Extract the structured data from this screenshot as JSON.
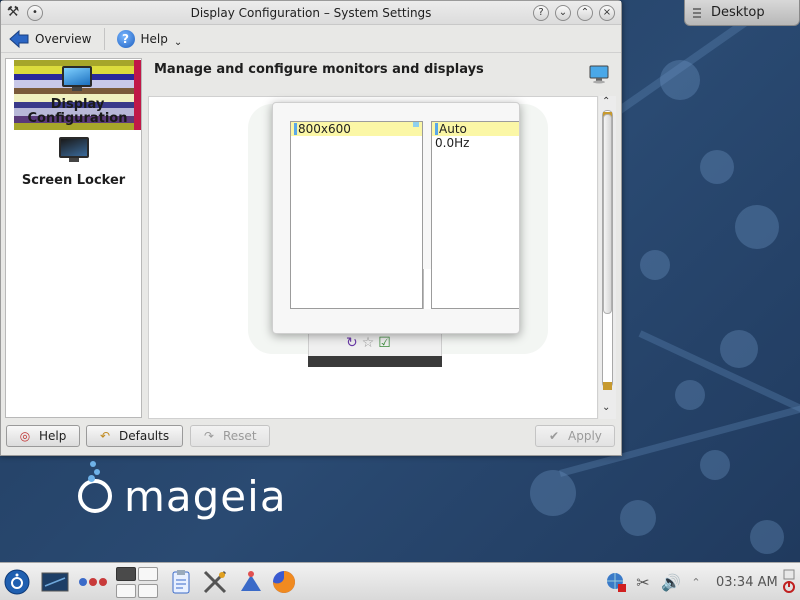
{
  "window": {
    "title": "Display Configuration – System Settings",
    "buttons": {
      "menu": "⚒",
      "pin": "•",
      "help": "?",
      "minimize": "⌄",
      "maximize": "⌃",
      "close": "×"
    }
  },
  "toolbar": {
    "overview_label": "Overview",
    "help_label": "Help",
    "help_arrow": "⌄"
  },
  "sidebar": {
    "items": [
      {
        "label_line1": "Display",
        "label_line2": "Configuration",
        "selected": true,
        "icon": "monitor-icon"
      },
      {
        "label": "Screen Locker",
        "selected": false,
        "icon": "screen-locker-icon"
      }
    ]
  },
  "main": {
    "heading": "Manage and configure monitors and displays"
  },
  "popup": {
    "resolutions": [
      {
        "label": "800x600",
        "selected": true
      }
    ],
    "refresh_rates": [
      {
        "label": "Auto",
        "selected": true
      },
      {
        "label": "0.0Hz",
        "selected": false
      }
    ]
  },
  "buttons": {
    "help": "Help",
    "defaults": "Defaults",
    "reset": "Reset",
    "apply": "Apply"
  },
  "desktop": {
    "desktop_button": "Desktop",
    "logo_text": "mageia"
  },
  "taskbar": {
    "clock": "03:34 AM"
  },
  "colors": {
    "accent": "#2b66c4",
    "selection": "#fbf7a6",
    "wallpaper": "#243f63"
  }
}
